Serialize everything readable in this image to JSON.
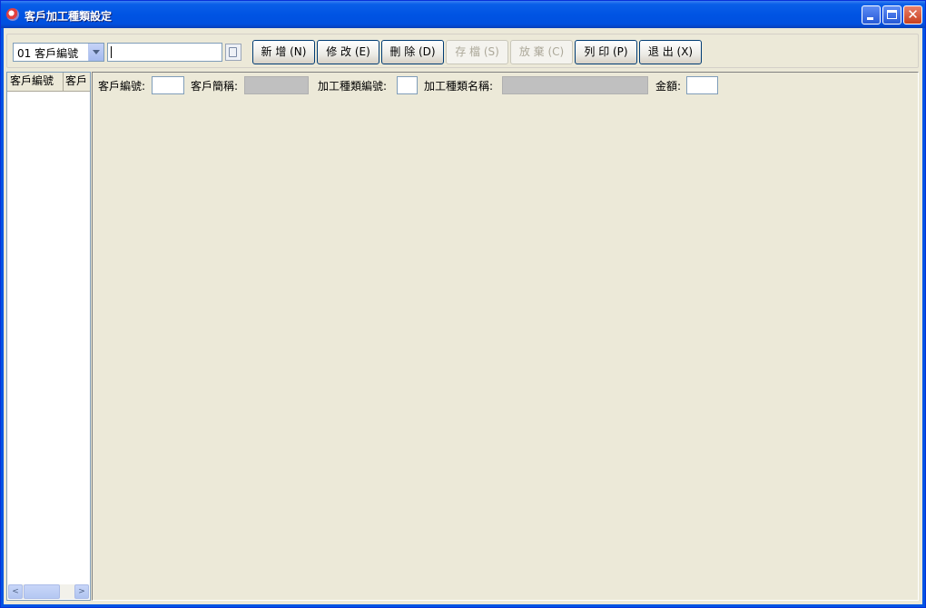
{
  "window": {
    "title": "客戶加工種類設定",
    "controls": {
      "minimize": "minimize-icon",
      "maximize": "maximize-icon",
      "close": "✕"
    }
  },
  "toolbar": {
    "search_field": {
      "selected": "01 客戶編號",
      "value": ""
    },
    "buttons": {
      "new": "新 增 (N)",
      "modify": "修 改 (E)",
      "delete": "刪 除 (D)",
      "save": "存 檔 (S)",
      "discard": "放 棄 (C)",
      "print": "列 印 (P)",
      "exit": "退 出 (X)"
    }
  },
  "grid": {
    "columns": [
      "客戶編號",
      "客戶"
    ],
    "rows": [],
    "scrollbar": {
      "left": "<",
      "right": ">"
    }
  },
  "detail": {
    "customer_no_label": "客戶編號:",
    "customer_no_value": "",
    "customer_short_label": "客戶簡稱:",
    "customer_short_value": "",
    "process_type_no_label": "加工種類編號:",
    "process_type_no_value": "",
    "process_type_name_label": "加工種類名稱:",
    "process_type_name_value": "",
    "amount_label": "金額:",
    "amount_value": ""
  },
  "colors": {
    "titlebar": "#0054e3",
    "face": "#ece9d8",
    "readonly_field": "#c0c0c0",
    "button_border": "#003c74"
  }
}
